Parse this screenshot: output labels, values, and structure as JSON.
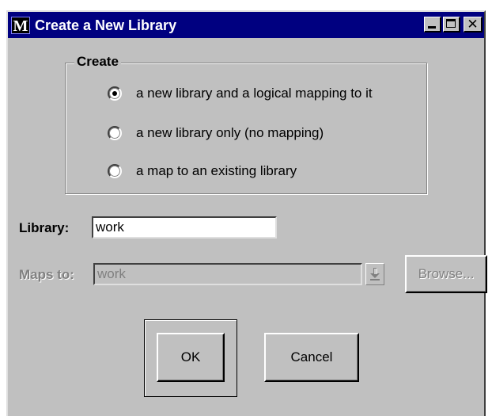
{
  "window": {
    "title": "Create a New Library",
    "icon_letter": "M",
    "icon": "mapping-app-icon",
    "controls": [
      "minimize-icon",
      "maximize-icon",
      "close-icon"
    ],
    "title_bar_color": "#000080",
    "face_color": "#c0c0c0"
  },
  "create_group": {
    "label": "Create",
    "options": [
      {
        "label": "a new library and a logical mapping to it",
        "selected": true
      },
      {
        "label": "a new library only (no mapping)",
        "selected": false
      },
      {
        "label": "a map to an existing library",
        "selected": false
      }
    ]
  },
  "library": {
    "label": "Library:",
    "value": "work"
  },
  "maps_to": {
    "label": "Maps to:",
    "value": "work",
    "enabled": false,
    "dropdown_icon": "down-arrow-icon"
  },
  "buttons": {
    "browse": "Browse...",
    "ok": "OK",
    "cancel": "Cancel",
    "default": "ok"
  }
}
